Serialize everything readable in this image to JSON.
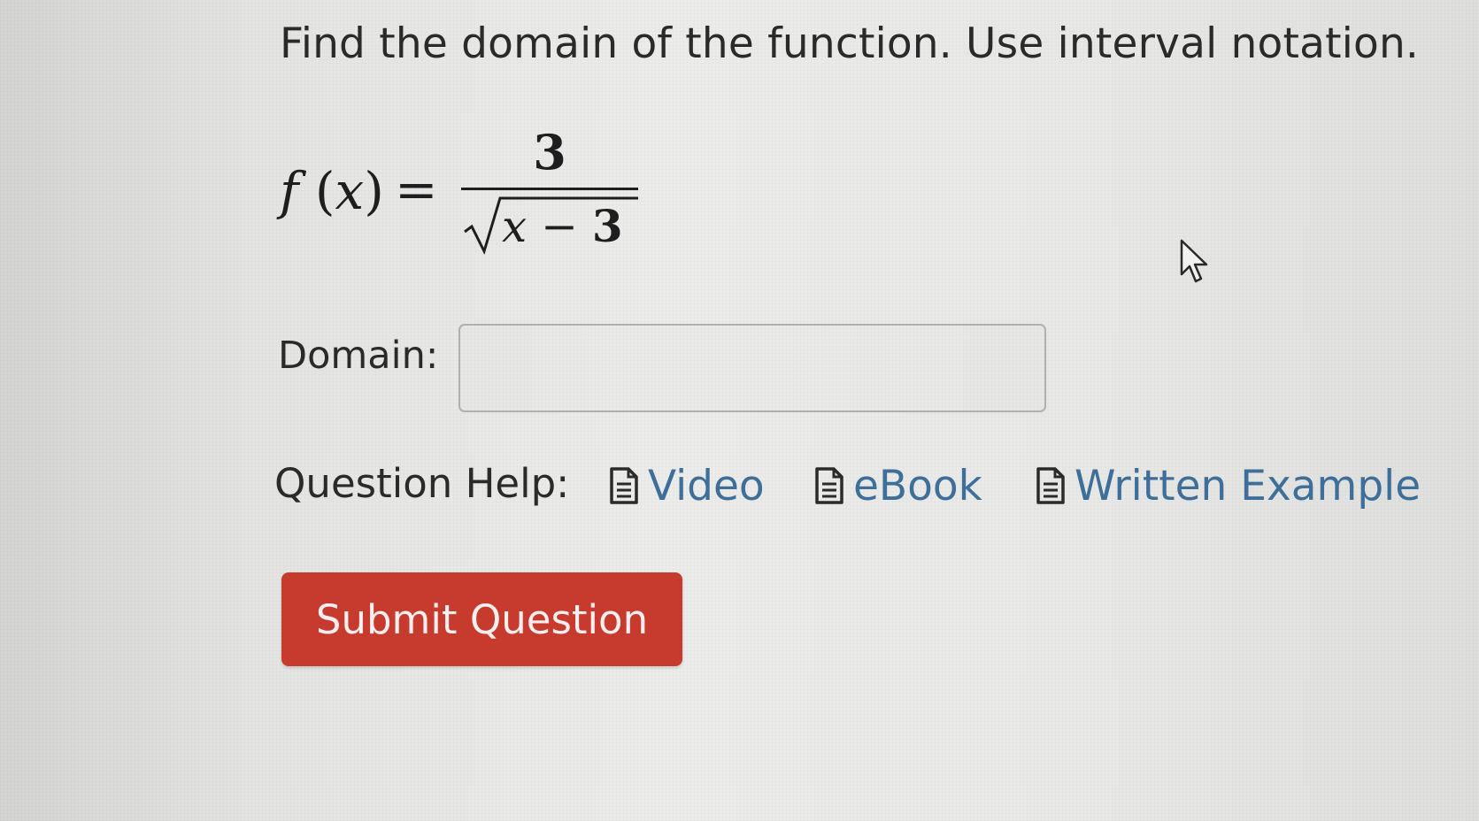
{
  "question": {
    "prompt": "Find the domain of the function. Use interval notation.",
    "formula": {
      "lhs_func": "f",
      "lhs_var": "x",
      "equals": "=",
      "numerator": "3",
      "radicand_var": "x",
      "radicand_op": "−",
      "radicand_const": "3"
    }
  },
  "answer": {
    "label": "Domain:",
    "value": "",
    "placeholder": ""
  },
  "help": {
    "label": "Question Help:",
    "links": [
      {
        "label": "Video",
        "icon": "document-icon"
      },
      {
        "label": "eBook",
        "icon": "document-icon"
      },
      {
        "label": "Written Example",
        "icon": "document-icon"
      }
    ]
  },
  "actions": {
    "submit_label": "Submit Question"
  },
  "colors": {
    "submit_bg": "#c73a2e",
    "link": "#3e6f9a",
    "text": "#2a2a2a"
  }
}
